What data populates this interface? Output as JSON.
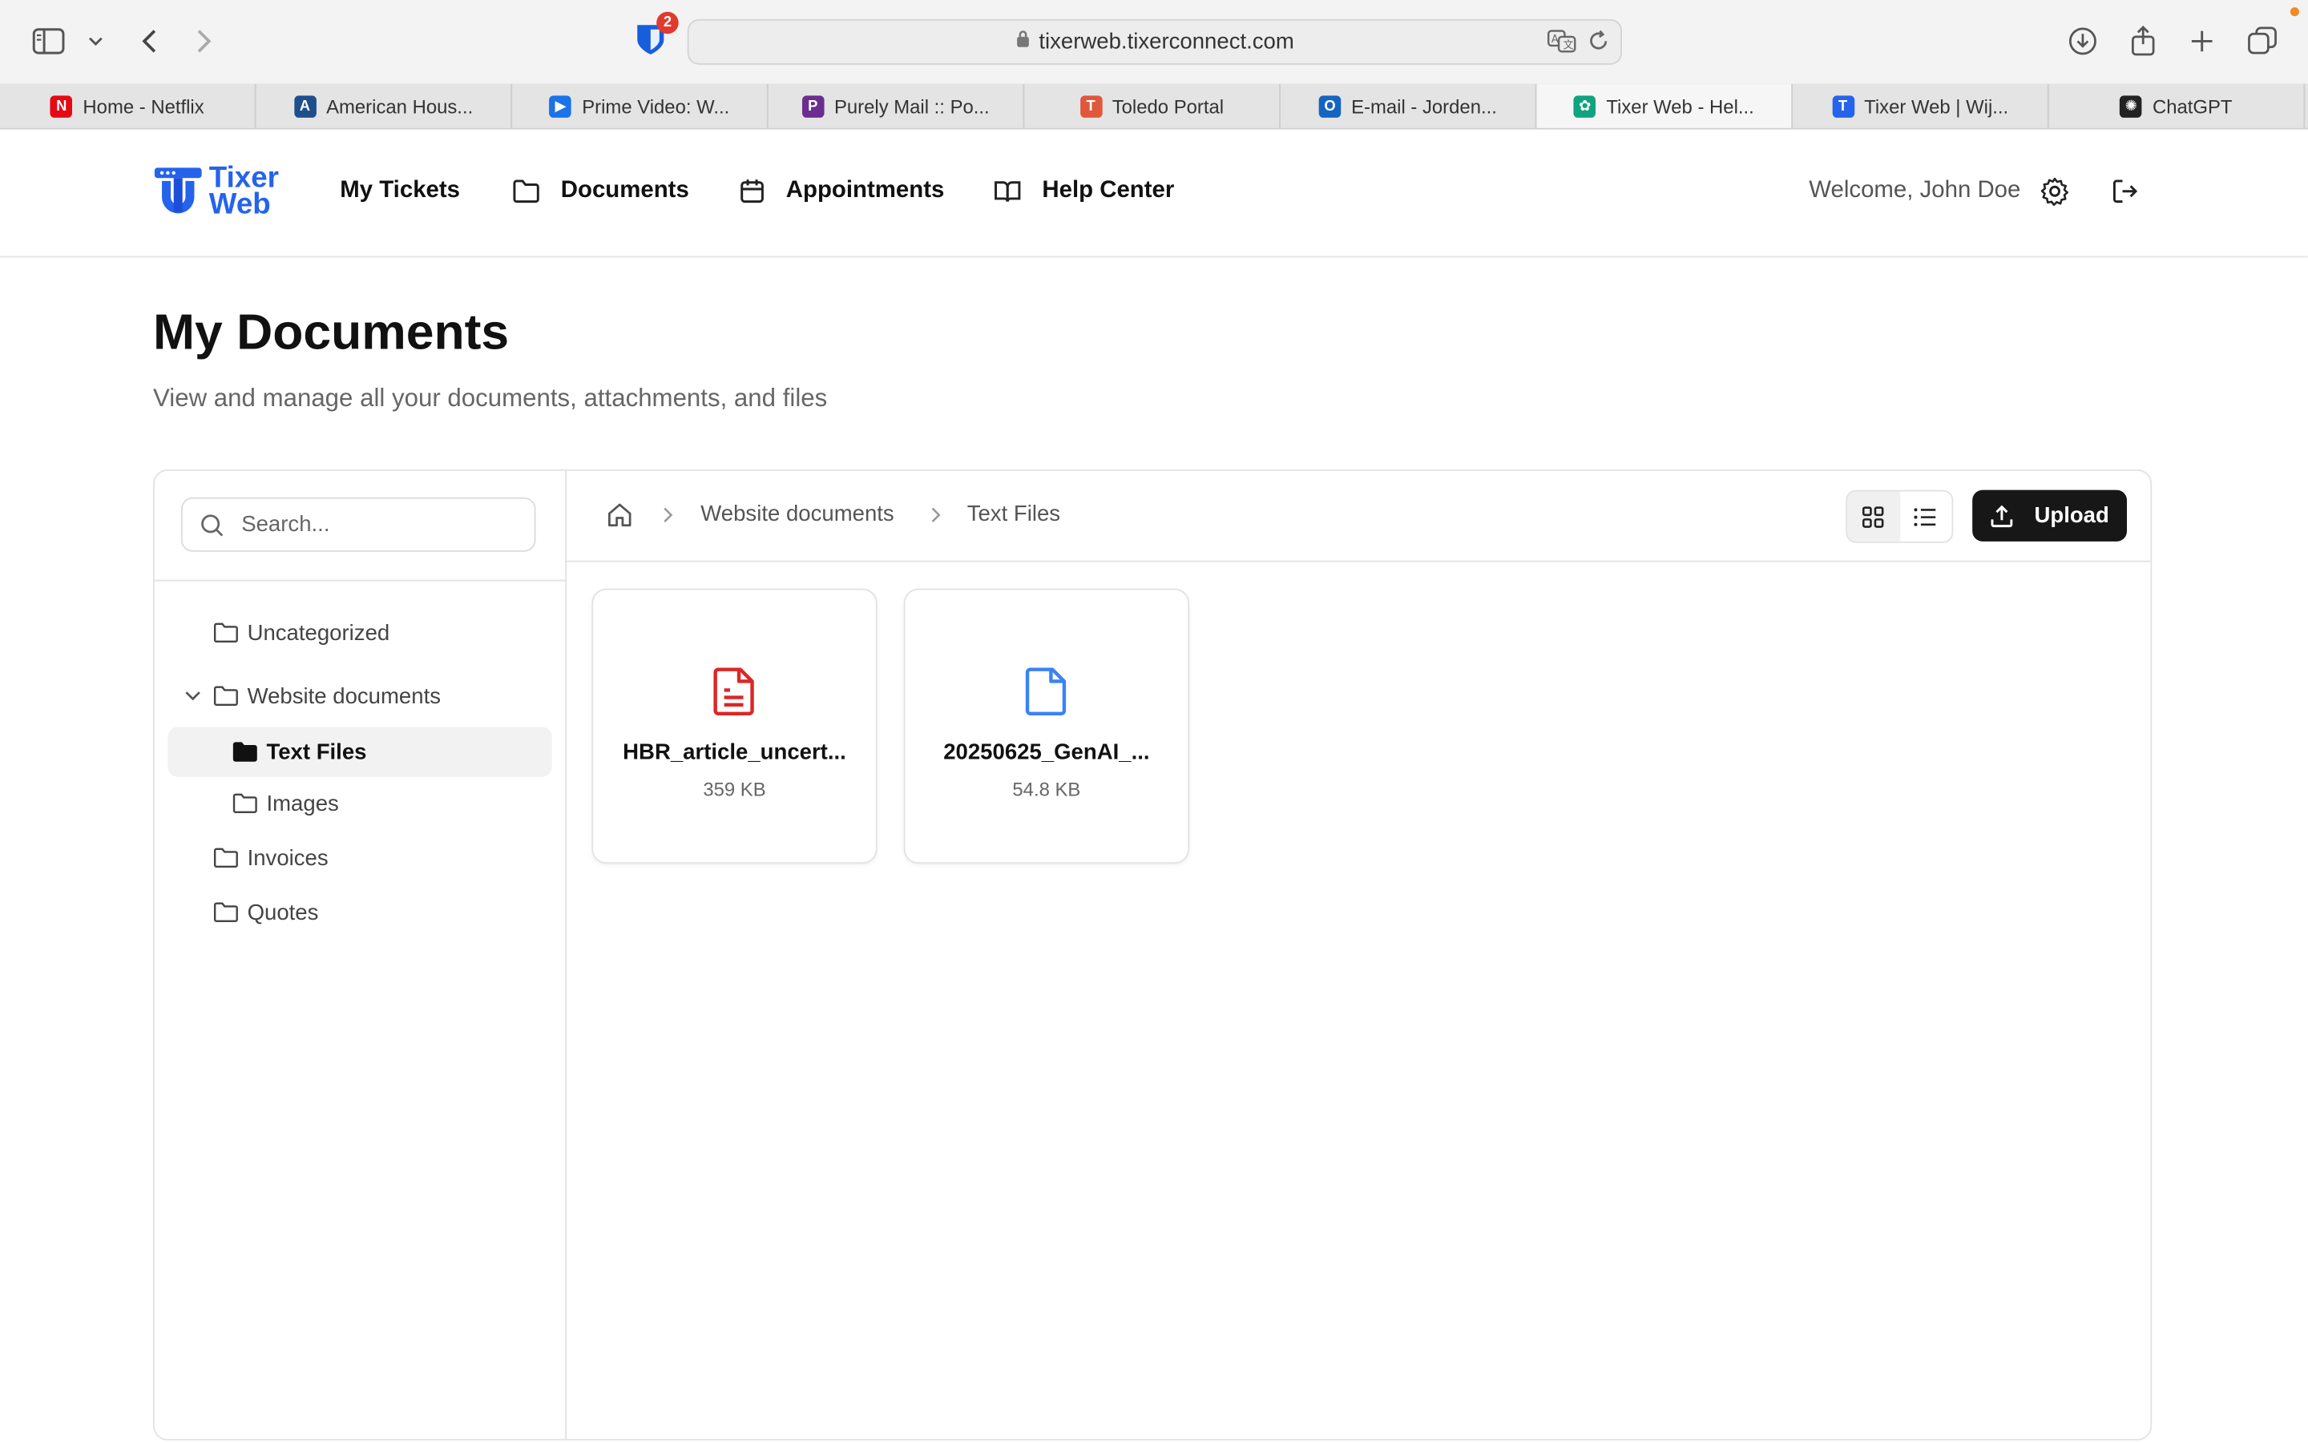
{
  "browser": {
    "url": "tixerweb.tixerconnect.com",
    "extension_badge": "2",
    "tabs": [
      {
        "label": "Home - Netflix",
        "fav_color": "#e50914",
        "fav_char": "N"
      },
      {
        "label": "American Hous...",
        "fav_color": "#1f4e8c",
        "fav_char": "A"
      },
      {
        "label": "Prime Video: W...",
        "fav_color": "#1a73e8",
        "fav_char": "▶"
      },
      {
        "label": "Purely Mail :: Po...",
        "fav_color": "#6b2d8f",
        "fav_char": "P"
      },
      {
        "label": "Toledo Portal",
        "fav_color": "#e0573b",
        "fav_char": "T"
      },
      {
        "label": "E-mail - Jorden...",
        "fav_color": "#1565c0",
        "fav_char": "O"
      },
      {
        "label": "Tixer Web - Hel...",
        "fav_color": "#10a37f",
        "fav_char": "✿"
      },
      {
        "label": "Tixer Web | Wij...",
        "fav_color": "#2563eb",
        "fav_char": "T"
      },
      {
        "label": "ChatGPT",
        "fav_color": "#222222",
        "fav_char": "✺"
      }
    ],
    "active_tab_index": 6
  },
  "app": {
    "logo_line1": "Tixer",
    "logo_line2": "Web",
    "brand_color": "#2563eb",
    "nav": {
      "my_tickets": "My Tickets",
      "documents": "Documents",
      "appointments": "Appointments",
      "help_center": "Help Center"
    },
    "welcome": "Welcome, John Doe"
  },
  "page": {
    "title": "My Documents",
    "subtitle": "View and manage all your documents, attachments, and files"
  },
  "sidebar": {
    "search_placeholder": "Search...",
    "folders": {
      "uncategorized": "Uncategorized",
      "website_documents": "Website documents",
      "text_files": "Text Files",
      "images": "Images",
      "invoices": "Invoices",
      "quotes": "Quotes"
    }
  },
  "breadcrumb": {
    "level1": "Website documents",
    "level2": "Text Files"
  },
  "toolbar": {
    "upload_label": "Upload",
    "view_mode": "grid"
  },
  "files": [
    {
      "name": "HBR_article_uncert...",
      "size": "359 KB",
      "icon": "pdf-file-icon",
      "color": "#dc2626"
    },
    {
      "name": "20250625_GenAI_...",
      "size": "54.8 KB",
      "icon": "file-icon",
      "color": "#3b82f6"
    }
  ]
}
